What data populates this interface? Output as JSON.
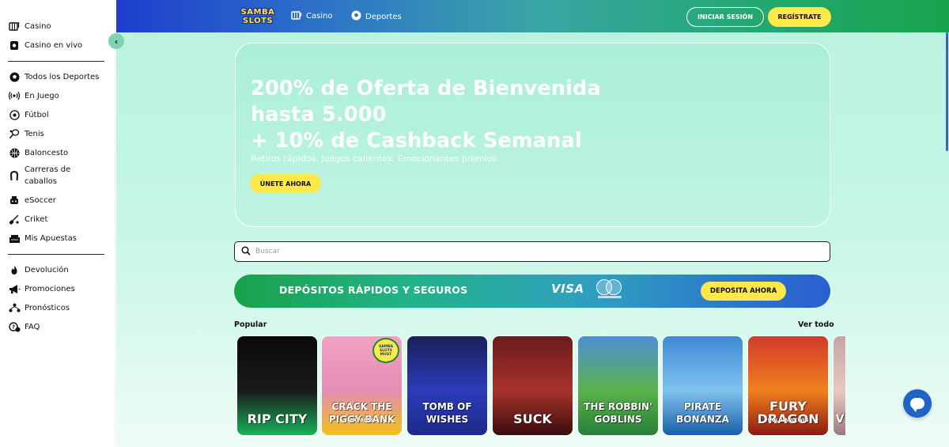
{
  "sidebar": {
    "casino_items": [
      {
        "label": "Casino",
        "icon": "slot-machine-icon"
      },
      {
        "label": "Casino en vivo",
        "icon": "live-cards-icon"
      }
    ],
    "sports_items": [
      {
        "label": "Todos los Deportes",
        "icon": "soccer-ball-icon"
      },
      {
        "label": "En Juego",
        "icon": "live-signal-icon"
      },
      {
        "label": "Fútbol",
        "icon": "football-icon"
      },
      {
        "label": "Tenis",
        "icon": "tennis-icon"
      },
      {
        "label": "Baloncesto",
        "icon": "basketball-icon"
      },
      {
        "label": "Carreras de caballos",
        "icon": "horseshoe-icon"
      },
      {
        "label": "eSoccer",
        "icon": "gamepad-icon"
      },
      {
        "label": "Criket",
        "icon": "cricket-icon"
      },
      {
        "label": "Mis Apuestas",
        "icon": "bets-icon"
      }
    ],
    "extra_items": [
      {
        "label": "Devolución",
        "icon": "fire-icon"
      },
      {
        "label": "Promociones",
        "icon": "megaphone-icon"
      },
      {
        "label": "Pronósticos",
        "icon": "chart-icon"
      },
      {
        "label": "FAQ",
        "icon": "question-icon"
      }
    ],
    "collapse_icon": "‹"
  },
  "header": {
    "logo_line1": "SAMBA",
    "logo_line2": "SLOTS",
    "nav": [
      {
        "label": "Casino",
        "icon": "slot-machine-icon"
      },
      {
        "label": "Deportes",
        "icon": "soccer-ball-icon"
      }
    ],
    "login_label": "INICIAR SESIÓN",
    "register_label": "REGÍSTRATE"
  },
  "hero": {
    "title_line1": "200% de Oferta de Bienvenida",
    "title_line2": "hasta 5.000",
    "title_line3": "+ 10% de Cashback Semanal",
    "subtitle": "Retiros rápidos. Juegos calientes. Emocionantes premios.",
    "cta_label": "ÚNETE AHORA"
  },
  "search": {
    "placeholder": "Buscar",
    "value": ""
  },
  "deposit_banner": {
    "text": "DEPÓSITOS RÁPIDOS Y SEGUROS",
    "visa_label": "VISA",
    "button_label": "DEPOSITA AHORA"
  },
  "popular": {
    "label": "Popular",
    "see_all_label": "Ver todo",
    "games": [
      {
        "title": "RIP CITY",
        "subtitle": "",
        "colors": [
          "#0a0a0a",
          "#1a1a1a",
          "#19b35a"
        ]
      },
      {
        "title": "CRACK THE PIGGY BANK",
        "subtitle": "EXPRESS",
        "colors": [
          "#f3a3c4",
          "#e38db3",
          "#f2c21b"
        ],
        "badge": "SAMBA SLOTS MUST"
      },
      {
        "title": "TOMB OF WISHES",
        "subtitle": "",
        "colors": [
          "#1b1f5a",
          "#2c3bb8",
          "#1b2a8a"
        ]
      },
      {
        "title": "SUCK",
        "subtitle": "",
        "colors": [
          "#6a1b1b",
          "#a8322c",
          "#3a0d0d"
        ]
      },
      {
        "title": "THE ROBBIN' GOBLINS",
        "subtitle": "",
        "colors": [
          "#4e8fd6",
          "#5ab24a",
          "#2a7f3a"
        ]
      },
      {
        "title": "PIRATE BONANZA",
        "subtitle": "",
        "colors": [
          "#3f8ad4",
          "#7fc3f0",
          "#1c5ea8"
        ]
      },
      {
        "title": "FURY DRAGON",
        "subtitle": "HOLD AND WIN",
        "colors": [
          "#d23a2a",
          "#f0801f",
          "#8c1a12"
        ]
      },
      {
        "title": "VI",
        "subtitle": "",
        "colors": [
          "#c7a2a7",
          "#e7c9c0",
          "#9c7a80"
        ]
      }
    ]
  }
}
